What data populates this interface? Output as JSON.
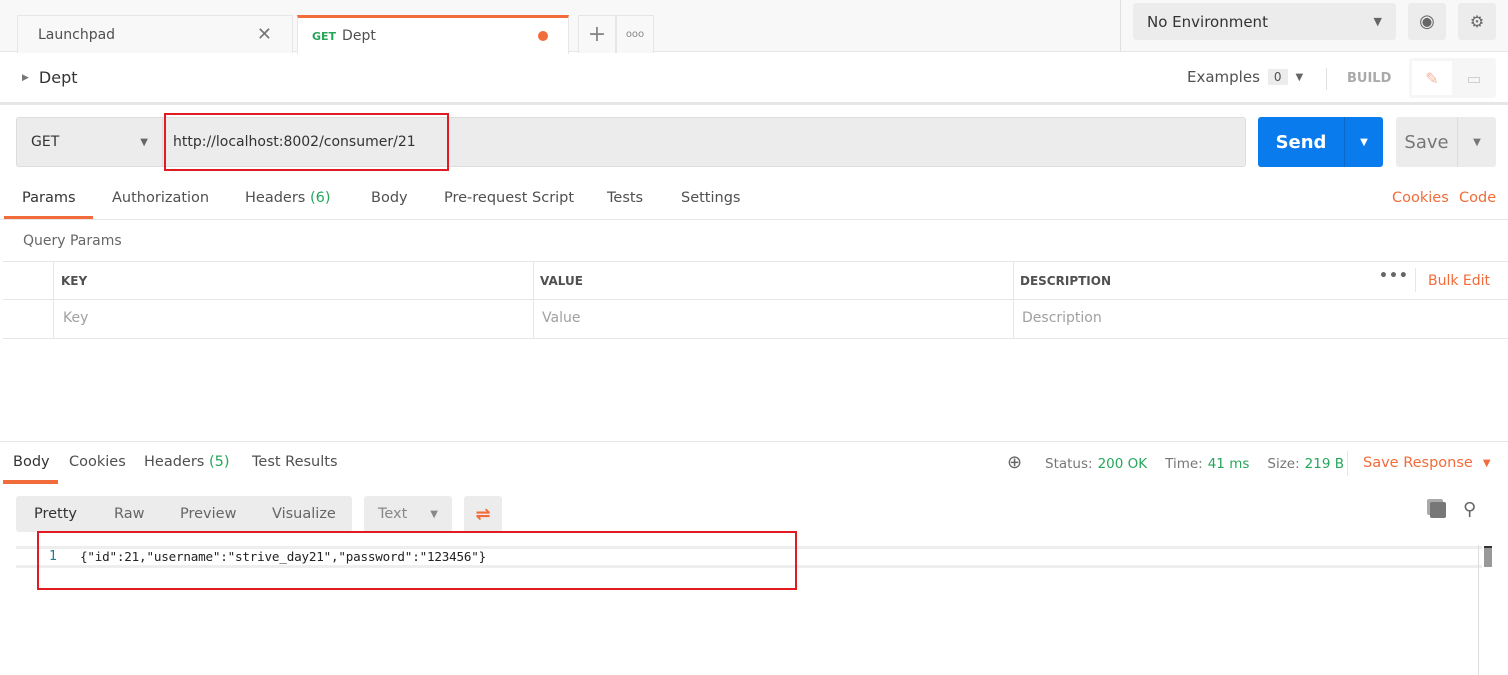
{
  "tabs": [
    {
      "label": "Launchpad"
    },
    {
      "method": "GET",
      "label": "Dept"
    }
  ],
  "environment": {
    "selected": "No Environment"
  },
  "request": {
    "name": "Dept",
    "examples_label": "Examples",
    "examples_count": "0",
    "build_label": "BUILD",
    "method": "GET",
    "url": "http://localhost:8002/consumer/21",
    "send_label": "Send",
    "save_label": "Save"
  },
  "param_tabs": [
    {
      "label": "Params"
    },
    {
      "label": "Authorization"
    },
    {
      "label": "Headers",
      "count": "(6)"
    },
    {
      "label": "Body"
    },
    {
      "label": "Pre-request Script"
    },
    {
      "label": "Tests"
    },
    {
      "label": "Settings"
    }
  ],
  "links": {
    "cookies": "Cookies",
    "code": "Code"
  },
  "query_params": {
    "title": "Query Params",
    "columns": [
      "KEY",
      "VALUE",
      "DESCRIPTION"
    ],
    "bulk_edit": "Bulk Edit",
    "placeholders": [
      "Key",
      "Value",
      "Description"
    ]
  },
  "response": {
    "tabs": [
      {
        "label": "Body"
      },
      {
        "label": "Cookies"
      },
      {
        "label": "Headers",
        "count": "(5)"
      },
      {
        "label": "Test Results"
      }
    ],
    "status_label": "Status:",
    "status": "200 OK",
    "time_label": "Time:",
    "time": "41 ms",
    "size_label": "Size:",
    "size": "219 B",
    "save_response": "Save Response",
    "view_modes": [
      "Pretty",
      "Raw",
      "Preview",
      "Visualize"
    ],
    "format": "Text",
    "line_number": "1",
    "body": "{\"id\":21,\"username\":\"strive_day21\",\"password\":\"123456\"}"
  },
  "colors": {
    "accent": "#f26b3a",
    "send": "#097bed",
    "success": "#26a65b",
    "highlight": "#e21a22"
  }
}
